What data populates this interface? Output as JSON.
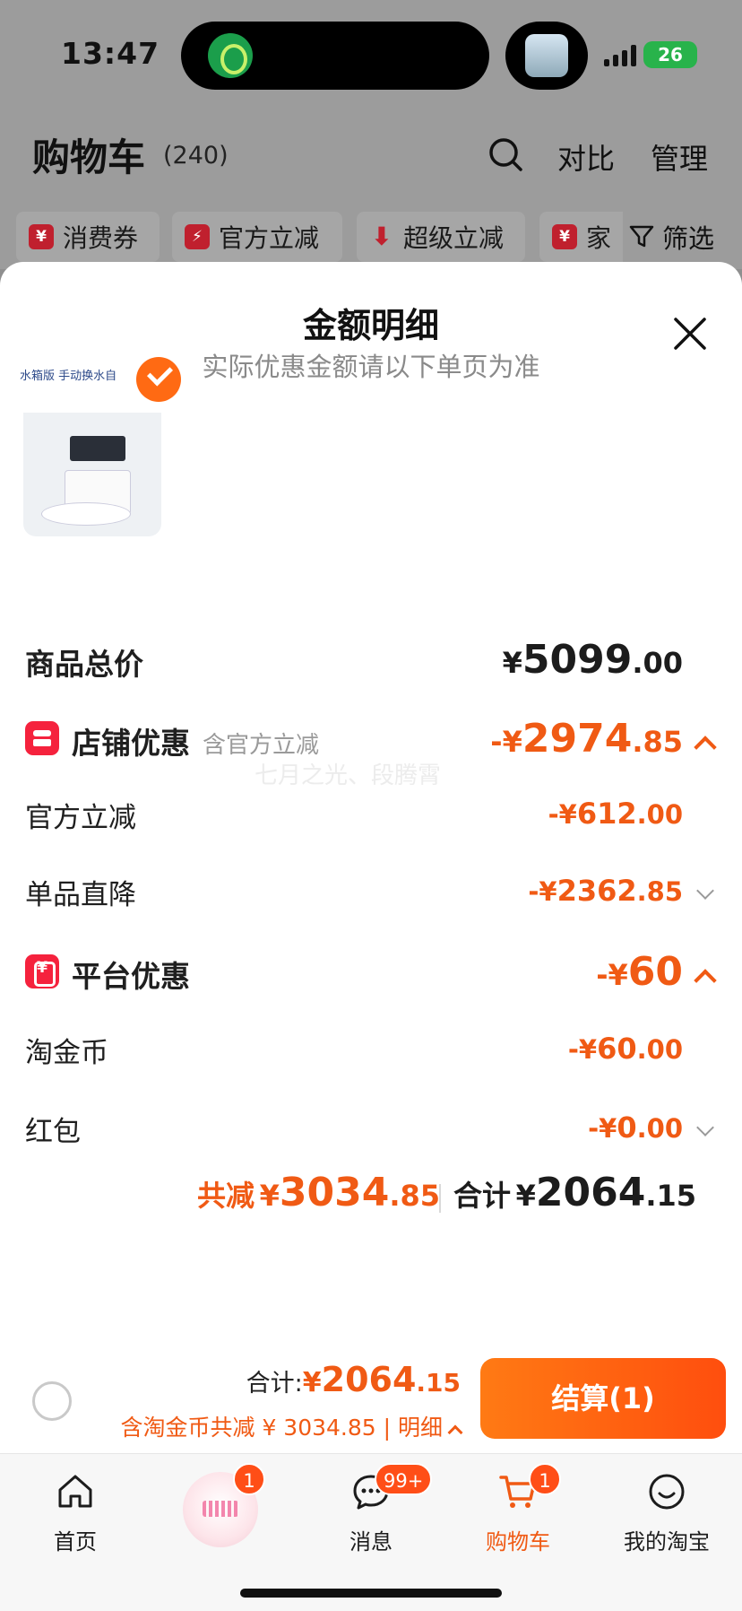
{
  "status_bar": {
    "time": "13:47",
    "battery": "26"
  },
  "cart_header": {
    "title": "购物车",
    "count": "(240)",
    "compare": "对比",
    "manage": "管理"
  },
  "chips": [
    {
      "icon": "¥",
      "label": "消费券"
    },
    {
      "icon": "⚡",
      "label": "官方立减"
    },
    {
      "icon": "⬇",
      "label": "超级立减"
    },
    {
      "icon": "¥",
      "label": "家"
    }
  ],
  "filter": {
    "label": "筛选"
  },
  "sheet": {
    "title": "金额明细",
    "subtitle": "实际优惠金额请以下单页为准"
  },
  "product": {
    "caption": "水箱版 手动换水自"
  },
  "watermark": "七月之光、段腾霄",
  "rows": {
    "total": {
      "label": "商品总价",
      "sym": "¥",
      "int": "5099",
      "dec": ".00"
    },
    "shop": {
      "label": "店铺优惠",
      "note": "含官方立减",
      "sym": "-¥",
      "int": "2974",
      "dec": ".85"
    },
    "official": {
      "label": "官方立减",
      "sym": "-¥",
      "int": "612",
      "dec": ".00"
    },
    "direct": {
      "label": "单品直降",
      "sym": "-¥",
      "int": "2362",
      "dec": ".85"
    },
    "platform": {
      "label": "平台优惠",
      "sym": "-¥",
      "int": "60",
      "dec": ""
    },
    "coins": {
      "label": "淘金币",
      "sym": "-¥",
      "int": "60",
      "dec": ".00"
    },
    "redpacket": {
      "label": "红包",
      "sym": "-¥",
      "int": "0",
      "dec": ".00"
    }
  },
  "summary": {
    "discount_label": "共减",
    "discount_sym": "¥",
    "discount_int": "3034",
    "discount_dec": ".85",
    "total_label": "合计",
    "total_sym": "¥",
    "total_int": "2064",
    "total_dec": ".15"
  },
  "checkout": {
    "total_label": "合计:",
    "total_sym": "¥",
    "total_int": "2064",
    "total_dec": ".15",
    "detail": "含淘金币共减 ¥ 3034.85 | 明细",
    "button": "结算(1)"
  },
  "tabs": [
    {
      "label": "首页",
      "icon": "home-icon"
    },
    {
      "label": "",
      "icon": "promo-icon",
      "badge": "1"
    },
    {
      "label": "消息",
      "icon": "message-icon",
      "badge": "99+"
    },
    {
      "label": "购物车",
      "icon": "cart-icon",
      "badge": "1",
      "active": true
    },
    {
      "label": "我的淘宝",
      "icon": "profile-icon"
    }
  ],
  "colors": {
    "accent": "#f05a14",
    "button": "#ff6a13",
    "badge": "#ff4e17",
    "shop_icon": "#f5223d"
  }
}
